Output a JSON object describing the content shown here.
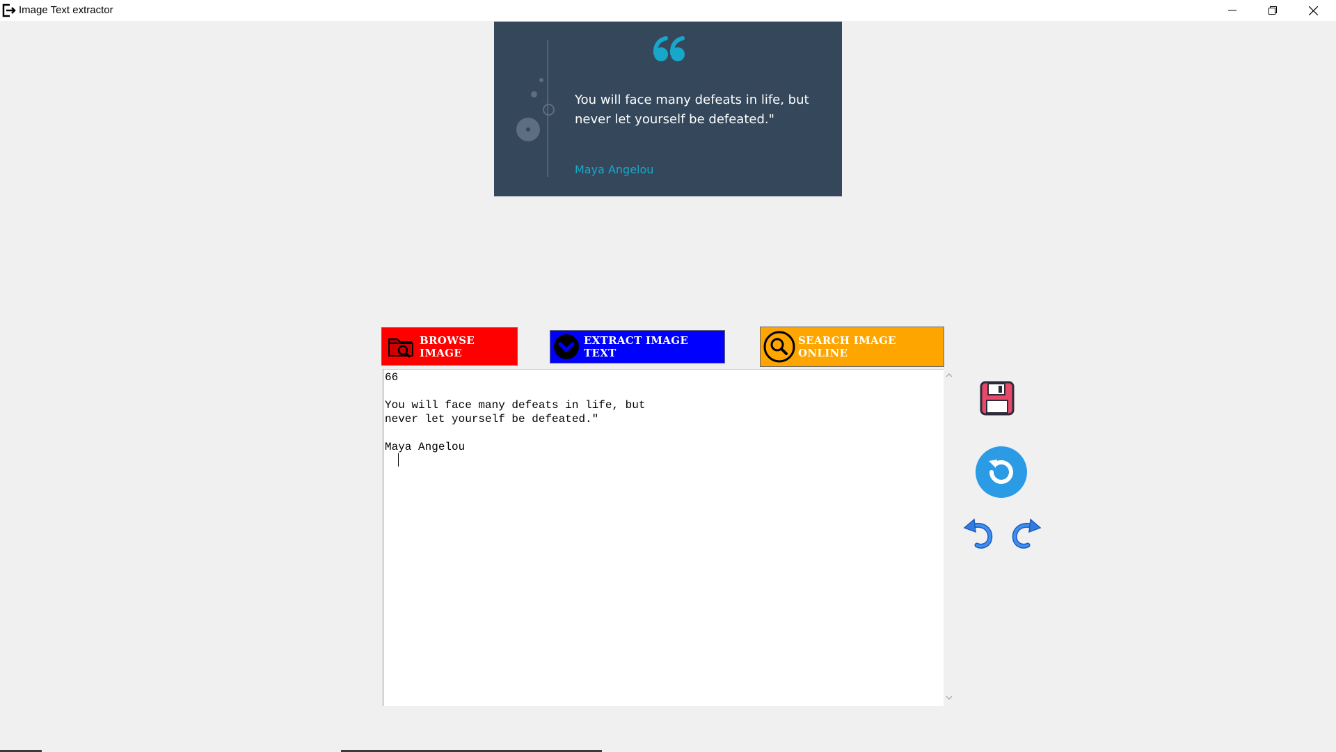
{
  "window": {
    "title": "Image Text extractor",
    "app_icon": "exit-icon",
    "controls": [
      "minimize-icon",
      "restore-icon",
      "close-icon"
    ]
  },
  "preview": {
    "quote_icon": "quote-mark-icon",
    "quote_text": "You will face many defeats in life, but\nnever let yourself be defeated.\"",
    "author": "Maya Angelou",
    "colors": {
      "background": "#35485b",
      "accent": "#19a7c9",
      "text": "#ffffff"
    }
  },
  "toolbar": {
    "browse_label": "BROWSE IMAGE",
    "browse_icon": "folder-search-icon",
    "extract_label": "EXTRACT IMAGE TEXT",
    "extract_icon": "chevron-down-circle-icon",
    "search_label": "SEARCH IMAGE ONLINE",
    "search_icon": "magnifier-icon",
    "colors": {
      "browse": "#ff0000",
      "extract": "#0000ff",
      "search": "#ffa500"
    }
  },
  "editor": {
    "content": "66\n\nYou will face many defeats in life, but\nnever let yourself be defeated.\"\n\nMaya Angelou"
  },
  "side_tools": {
    "save_icon": "floppy-disk-icon",
    "reset_icon": "refresh-icon",
    "undo_icon": "undo-icon",
    "redo_icon": "redo-icon"
  }
}
